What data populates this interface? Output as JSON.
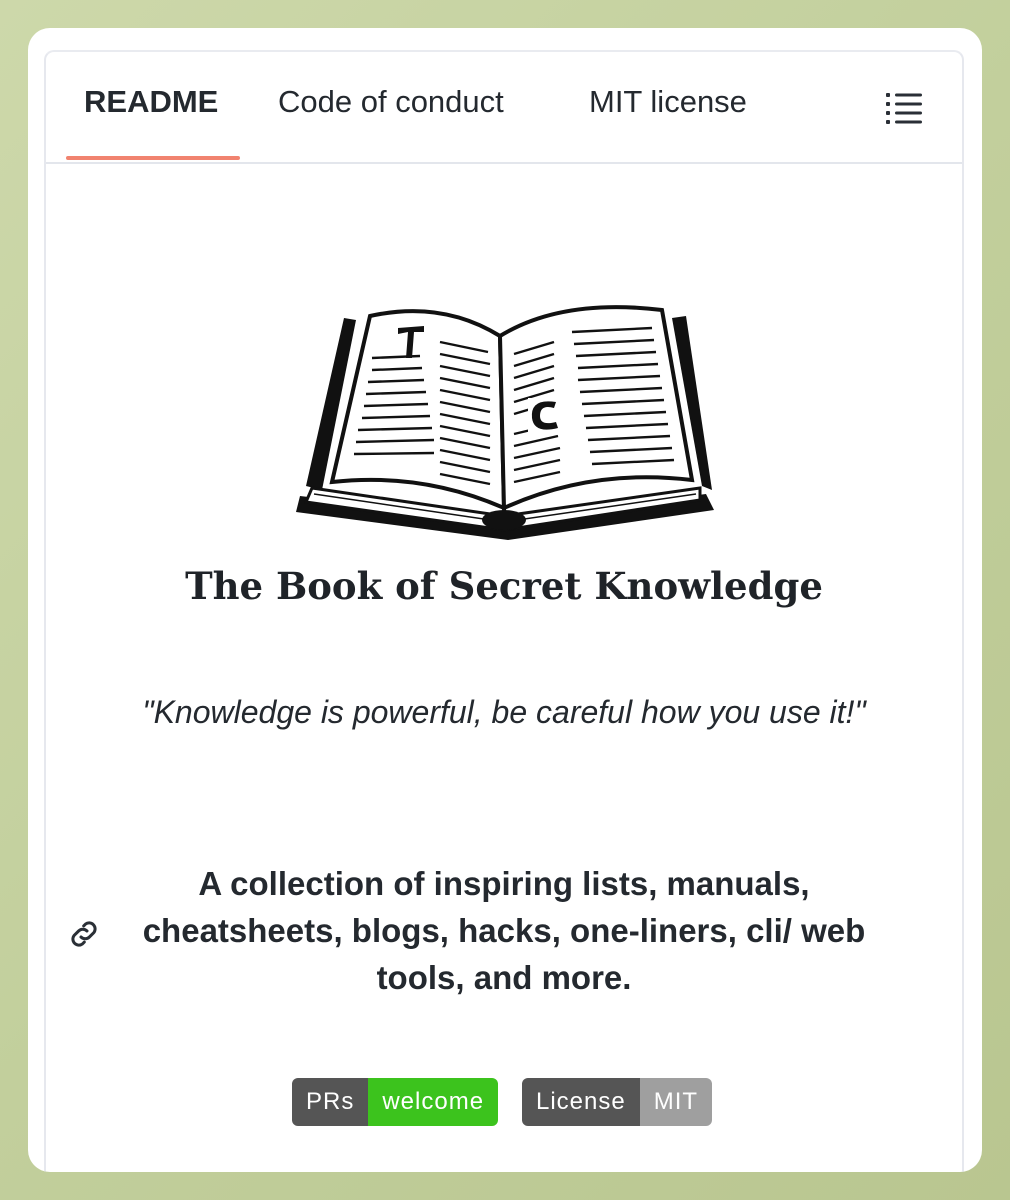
{
  "tabs": {
    "readme": "README",
    "code_of_conduct": "Code of conduct",
    "license": "MIT license",
    "toc_icon": "list-icon",
    "active_color": "#f1836f"
  },
  "readme": {
    "image": "open-book-illustration",
    "title": "The Book of Secret Knowledge",
    "quote": "\"Knowledge is powerful, be careful how you use it!\"",
    "description": "A collection of inspiring lists, manuals, cheatsheets, blogs, hacks, one-liners, cli/ web tools, and more.",
    "anchor_icon": "link-icon"
  },
  "badges": [
    {
      "label": "PRs",
      "message": "welcome",
      "color": "#3cc31d"
    },
    {
      "label": "License",
      "message": "MIT",
      "color": "#9f9f9f"
    }
  ]
}
